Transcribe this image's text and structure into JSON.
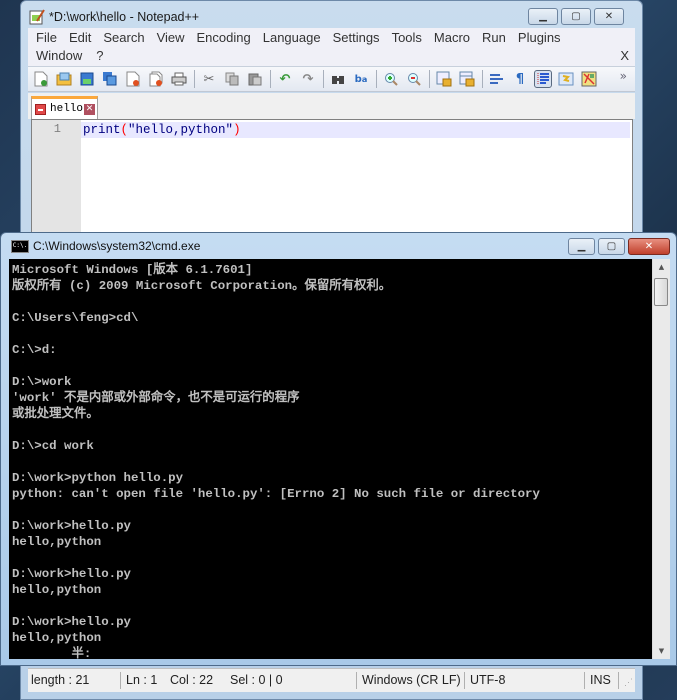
{
  "notepad": {
    "title": "*D:\\work\\hello - Notepad++",
    "window_buttons": [
      "minimize",
      "maximize",
      "close"
    ],
    "menu_row1": [
      "File",
      "Edit",
      "Search",
      "View",
      "Encoding",
      "Language",
      "Settings",
      "Tools",
      "Macro",
      "Run",
      "Plugins"
    ],
    "menu_row2": [
      "Window",
      "?"
    ],
    "menu_close": "X",
    "toolbar_icons": [
      "new-file-icon",
      "open-file-icon",
      "save-icon",
      "save-all-icon",
      "close-icon",
      "close-all-icon",
      "print-icon",
      "sep",
      "cut-icon",
      "copy-icon",
      "paste-icon",
      "sep",
      "undo-icon",
      "redo-icon",
      "sep",
      "find-icon",
      "replace-icon",
      "sep",
      "zoom-in-icon",
      "zoom-out-icon",
      "sep",
      "sync-vertical-icon",
      "sync-horizontal-icon",
      "sep",
      "word-wrap-icon",
      "show-all-chars-icon",
      "indent-guide-icon",
      "udl-icon",
      "doc-map-icon"
    ],
    "toolbar_overflow": "»",
    "tab": {
      "name": "hello",
      "close": "✕"
    },
    "editor": {
      "line_number": "1",
      "code_keyword": "print",
      "code_open": "(",
      "code_string": "\"hello,python\"",
      "code_close": ")"
    },
    "status": {
      "length": "length : 21",
      "ln": "Ln : 1",
      "col": "Col : 22",
      "sel": "Sel : 0 | 0",
      "eol": "Windows (CR LF)",
      "encoding": "UTF-8",
      "mode": "INS"
    }
  },
  "cmd": {
    "title": "C:\\Windows\\system32\\cmd.exe",
    "icon_text": "C:\\.",
    "lines": [
      "Microsoft Windows [版本 6.1.7601]",
      "版权所有 (c) 2009 Microsoft Corporation。保留所有权利。",
      "",
      "C:\\Users\\feng>cd\\",
      "",
      "C:\\>d:",
      "",
      "D:\\>work",
      "'work' 不是内部或外部命令，也不是可运行的程序",
      "或批处理文件。",
      "",
      "D:\\>cd work",
      "",
      "D:\\work>python hello.py",
      "python: can't open file 'hello.py': [Errno 2] No such file or directory",
      "",
      "D:\\work>hello.py",
      "hello,python",
      "",
      "D:\\work>hello.py",
      "hello,python",
      "",
      "D:\\work>hello.py",
      "hello,python",
      "        半:"
    ]
  }
}
